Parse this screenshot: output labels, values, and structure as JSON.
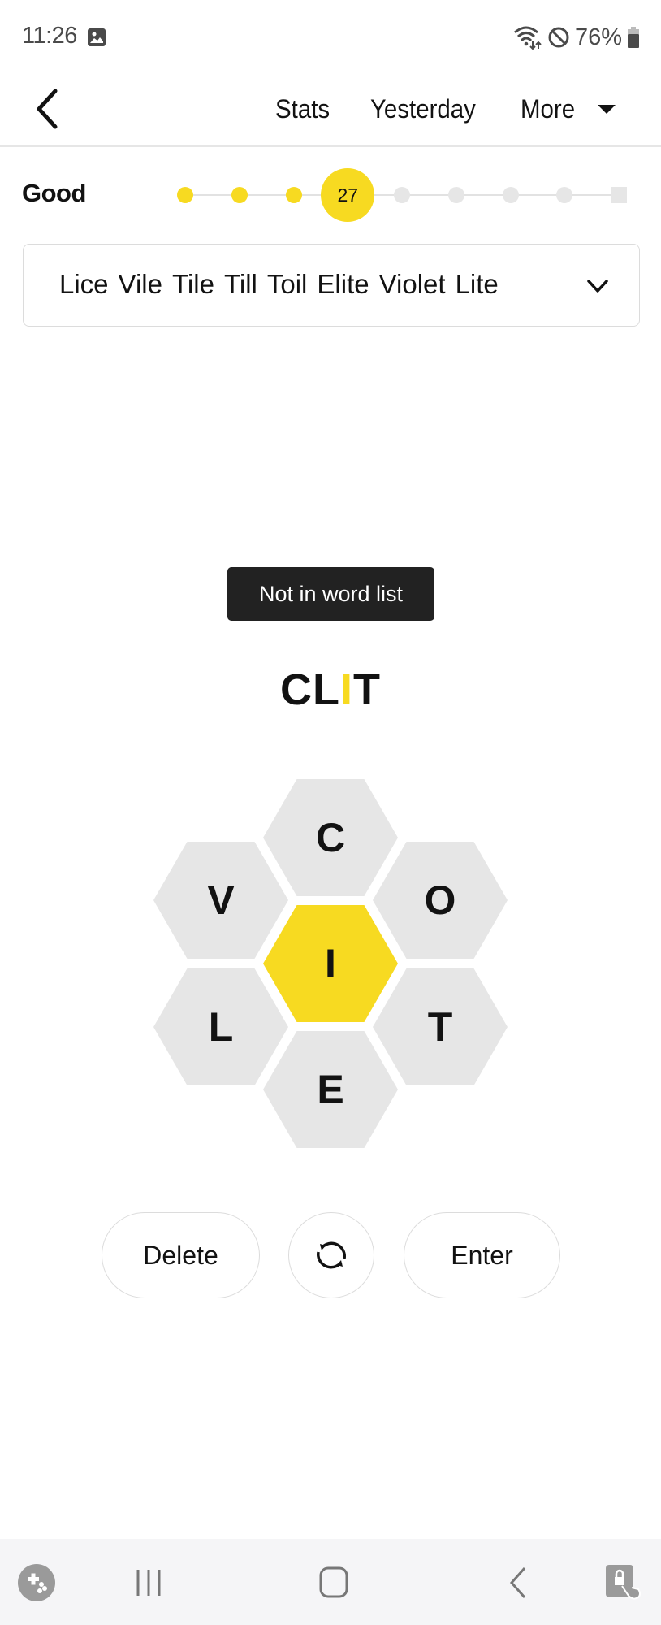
{
  "status_bar": {
    "time": "11:26",
    "battery_percent": "76%",
    "icons": [
      "image-icon",
      "wifi-icon",
      "do-not-disturb-icon",
      "battery-icon"
    ]
  },
  "header": {
    "back_icon": "back-chevron-icon",
    "links": [
      "Stats",
      "Yesterday"
    ],
    "more_label": "More",
    "more_icon": "caret-down-icon"
  },
  "rank": {
    "label": "Good",
    "score": "27",
    "current_level_index": 3,
    "total_levels": 9
  },
  "word_list": {
    "found_words": [
      "Lice",
      "Vile",
      "Tile",
      "Till",
      "Toil",
      "Elite",
      "Violet",
      "Lite"
    ],
    "expand_icon": "chevron-down-icon"
  },
  "toast": {
    "message": "Not in word list"
  },
  "input": {
    "letters": [
      "C",
      "L",
      "I",
      "T"
    ],
    "center_letter": "I"
  },
  "hive": {
    "center": "I",
    "outer": {
      "top": "C",
      "upper_left": "V",
      "upper_right": "O",
      "lower_left": "L",
      "lower_right": "T",
      "bottom": "E"
    }
  },
  "actions": {
    "delete_label": "Delete",
    "shuffle_icon": "shuffle-icon",
    "enter_label": "Enter"
  },
  "colors": {
    "accent_yellow": "#f7da21",
    "hex_gray": "#e6e6e6",
    "toast_bg": "#222222",
    "text": "#121212"
  },
  "android_nav": {
    "icons": [
      "game-launcher-icon",
      "recent-apps-icon",
      "home-icon",
      "back-icon",
      "screen-lock-icon"
    ]
  }
}
